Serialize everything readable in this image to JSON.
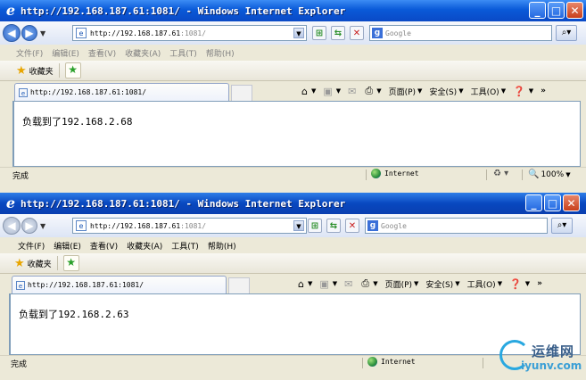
{
  "windows": [
    {
      "title": "http://192.168.187.61:1081/ - Windows Internet Explorer",
      "address": {
        "host": "http://192.168.187.61",
        "port": ":1081/"
      },
      "search_placeholder": "Google",
      "menu": [
        "文件(F)",
        "编辑(E)",
        "查看(V)",
        "收藏夹(A)",
        "工具(T)",
        "帮助(H)"
      ],
      "favorites_label": "收藏夹",
      "tab_title": "http://192.168.187.61:1081/",
      "commands": {
        "page": "页面(P)",
        "safety": "安全(S)",
        "tools": "工具(O)"
      },
      "page_text": "负载到了192.168.2.68",
      "status": "完成",
      "zone": "Internet",
      "zoom": "100%"
    },
    {
      "title": "http://192.168.187.61:1081/ - Windows Internet Explorer",
      "address": {
        "host": "http://192.168.187.61",
        "port": ":1081/"
      },
      "search_placeholder": "Google",
      "menu": [
        "文件(F)",
        "编辑(E)",
        "查看(V)",
        "收藏夹(A)",
        "工具(T)",
        "帮助(H)"
      ],
      "favorites_label": "收藏夹",
      "tab_title": "http://192.168.187.61:1081/",
      "commands": {
        "page": "页面(P)",
        "safety": "安全(S)",
        "tools": "工具(O)"
      },
      "page_text": "负载到了192.168.2.63",
      "status": "完成",
      "zone": "Internet"
    }
  ],
  "watermark": {
    "title": "运维网",
    "subtitle": "iyunv.com"
  },
  "colors": {
    "titlebar": "#0a5ad8",
    "close_button": "#c8401c",
    "window_bg": "#ece9d8"
  }
}
